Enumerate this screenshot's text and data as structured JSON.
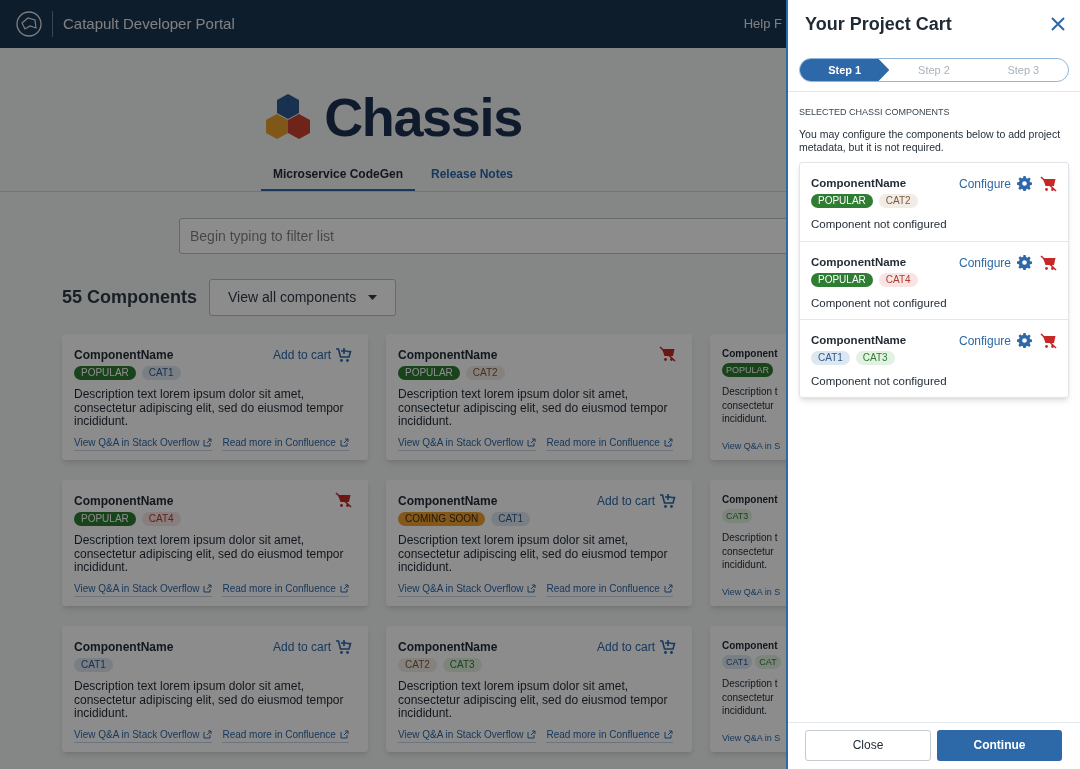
{
  "header": {
    "title": "Catapult Developer Portal",
    "help_link": "Help F"
  },
  "brand": {
    "name": "Chassis"
  },
  "tabs": [
    {
      "label": "Microservice CodeGen",
      "selected": true
    },
    {
      "label": "Release Notes",
      "selected": false
    }
  ],
  "filter": {
    "placeholder": "Begin typing to filter list"
  },
  "summary": {
    "count": "55 Components",
    "view_menu": "View all components"
  },
  "cards": [
    {
      "kind": "full",
      "name": "ComponentName",
      "in_cart": false,
      "add_label": "Add to cart",
      "tags": [
        {
          "kind": "popular",
          "label": "POPULAR"
        },
        {
          "kind": "cat1",
          "label": "CAT1"
        }
      ],
      "description": "Description text lorem ipsum dolor sit amet, consectetur adipiscing elit, sed do eiusmod tempor incididunt.",
      "links": [
        "View Q&A in Stack Overflow",
        "Read more in Confluence"
      ]
    },
    {
      "kind": "full",
      "name": "ComponentName",
      "in_cart": true,
      "tags": [
        {
          "kind": "popular",
          "label": "POPULAR"
        },
        {
          "kind": "cat2",
          "label": "CAT2"
        }
      ],
      "description": "Description text lorem ipsum dolor sit amet, consectetur adipiscing elit, sed do eiusmod tempor incididunt.",
      "links": [
        "View Q&A in Stack Overflow",
        "Read more in Confluence"
      ]
    },
    {
      "kind": "cut",
      "name": "Component",
      "tags": [
        {
          "kind": "popular",
          "label": "POPULAR"
        }
      ],
      "description_lines": [
        "Description t",
        "consectetur",
        "incididunt."
      ],
      "links": [
        "View Q&A in S"
      ]
    },
    {
      "kind": "full",
      "name": "ComponentName",
      "in_cart": true,
      "tags": [
        {
          "kind": "popular",
          "label": "POPULAR"
        },
        {
          "kind": "cat4",
          "label": "CAT4"
        }
      ],
      "description": "Description text lorem ipsum dolor sit amet, consectetur adipiscing elit, sed do eiusmod tempor incididunt.",
      "links": [
        "View Q&A in Stack Overflow",
        "Read more in Confluence"
      ]
    },
    {
      "kind": "full",
      "name": "ComponentName",
      "in_cart": false,
      "add_label": "Add to cart",
      "tags": [
        {
          "kind": "coming_soon",
          "label": "COMING SOON"
        },
        {
          "kind": "cat1",
          "label": "CAT1"
        }
      ],
      "description": "Description text lorem ipsum dolor sit amet, consectetur adipiscing elit, sed do eiusmod tempor incididunt.",
      "links": [
        "View Q&A in Stack Overflow",
        "Read more in Confluence"
      ]
    },
    {
      "kind": "cut",
      "name": "Component",
      "tags": [
        {
          "kind": "cat3",
          "label": "CAT3"
        }
      ],
      "description_lines": [
        "Description t",
        "consectetur",
        "incididunt."
      ],
      "links": [
        "View Q&A in S"
      ]
    },
    {
      "kind": "full",
      "name": "ComponentName",
      "in_cart": false,
      "add_label": "Add to cart",
      "tags": [
        {
          "kind": "cat1",
          "label": "CAT1"
        }
      ],
      "description": "Description text lorem ipsum dolor sit amet, consectetur adipiscing elit, sed do eiusmod tempor incididunt.",
      "links": [
        "View Q&A in Stack Overflow",
        "Read more in Confluence"
      ]
    },
    {
      "kind": "full",
      "name": "ComponentName",
      "in_cart": false,
      "add_label": "Add to cart",
      "tags": [
        {
          "kind": "cat2",
          "label": "CAT2"
        },
        {
          "kind": "cat3",
          "label": "CAT3"
        }
      ],
      "description": "Description text lorem ipsum dolor sit amet, consectetur adipiscing elit, sed do eiusmod tempor incididunt.",
      "links": [
        "View Q&A in Stack Overflow",
        "Read more in Confluence"
      ]
    },
    {
      "kind": "cut",
      "name": "Component",
      "tags": [
        {
          "kind": "cat1",
          "label": "CAT1"
        },
        {
          "kind": "cat3",
          "label": "CAT"
        }
      ],
      "description_lines": [
        "Description t",
        "consectetur",
        "incididunt."
      ],
      "links": [
        "View Q&A in S"
      ]
    }
  ],
  "cart": {
    "title": "Your Project Cart",
    "steps": [
      {
        "label": "Step 1",
        "selected": true
      },
      {
        "label": "Step 2",
        "selected": false
      },
      {
        "label": "Step 3",
        "selected": false
      }
    ],
    "section_label": "SELECTED CHASSI COMPONENTS",
    "intro": "You may configure the components below to add project metadata, but it is not required.",
    "items": [
      {
        "name": "ComponentName",
        "configure_label": "Configure",
        "tags": [
          {
            "kind": "popular",
            "label": "POPULAR"
          },
          {
            "kind": "cat2",
            "label": "CAT2"
          }
        ],
        "status": "Component not configured"
      },
      {
        "name": "ComponentName",
        "configure_label": "Configure",
        "tags": [
          {
            "kind": "popular",
            "label": "POPULAR"
          },
          {
            "kind": "cat4",
            "label": "CAT4"
          }
        ],
        "status": "Component not configured"
      },
      {
        "name": "ComponentName",
        "configure_label": "Configure",
        "tags": [
          {
            "kind": "cat1",
            "label": "CAT1"
          },
          {
            "kind": "cat3",
            "label": "CAT3"
          }
        ],
        "status": "Component not configured"
      }
    ],
    "buttons": {
      "close": "Close",
      "continue": "Continue"
    }
  }
}
